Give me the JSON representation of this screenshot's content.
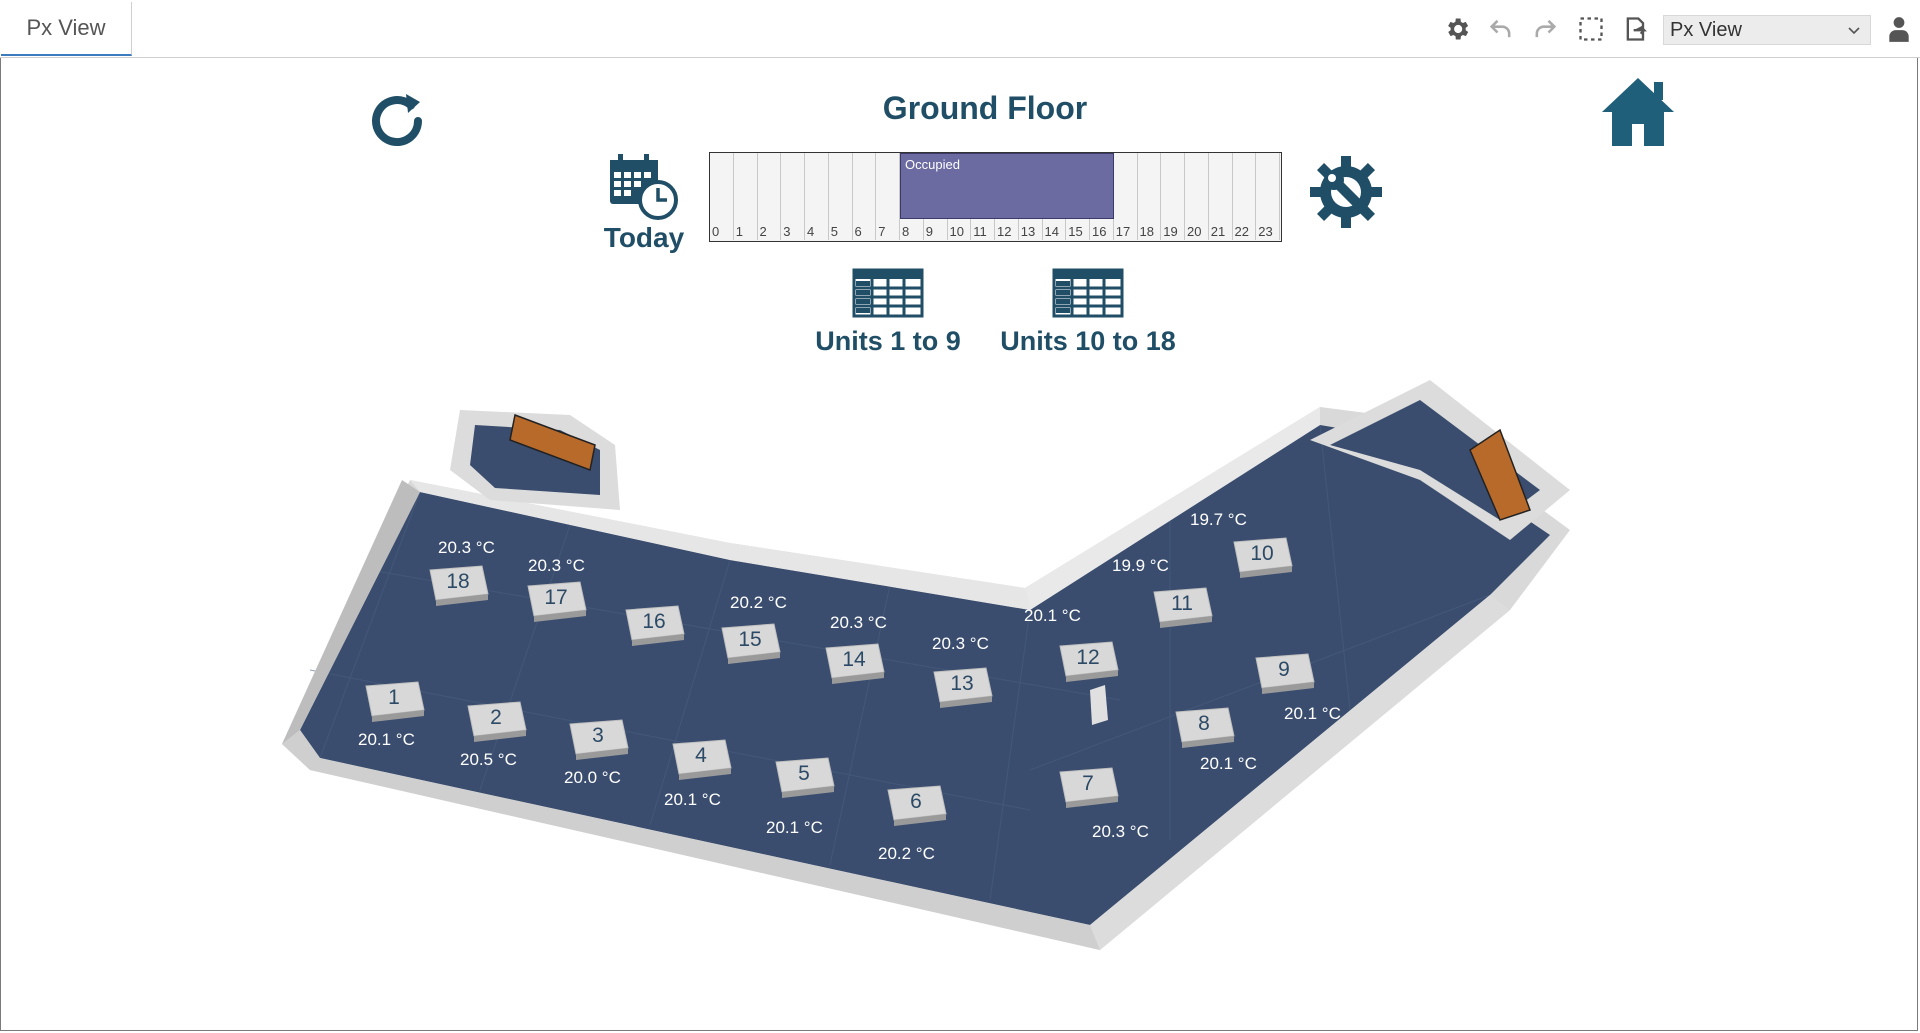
{
  "tab": {
    "label": "Px View"
  },
  "toolbar": {
    "icons": [
      "settings-icon",
      "undo-icon",
      "redo-icon",
      "selection-icon",
      "export-icon",
      "user-icon"
    ],
    "view_select": "Px View"
  },
  "header": {
    "title": "Ground Floor",
    "today_label": "Today",
    "units_a_label": "Units 1 to 9",
    "units_b_label": "Units 10 to 18"
  },
  "schedule": {
    "hours": [
      "0",
      "1",
      "2",
      "3",
      "4",
      "5",
      "6",
      "7",
      "8",
      "9",
      "10",
      "11",
      "12",
      "13",
      "14",
      "15",
      "16",
      "17",
      "18",
      "19",
      "20",
      "21",
      "22",
      "23"
    ],
    "occupied_label": "Occupied",
    "occupied_start": 8,
    "occupied_end": 17,
    "occupied_color": "#6b6aa1"
  },
  "colors": {
    "accent": "#1f4e66",
    "floor": "#3a4d6e"
  },
  "units": [
    {
      "id": "1",
      "temp": "20.1 °C"
    },
    {
      "id": "2",
      "temp": "20.5 °C"
    },
    {
      "id": "3",
      "temp": "20.0 °C"
    },
    {
      "id": "4",
      "temp": "20.1 °C"
    },
    {
      "id": "5",
      "temp": "20.1 °C"
    },
    {
      "id": "6",
      "temp": "20.2 °C"
    },
    {
      "id": "7",
      "temp": "20.3 °C"
    },
    {
      "id": "8",
      "temp": "20.1 °C"
    },
    {
      "id": "9",
      "temp": "20.1 °C"
    },
    {
      "id": "10",
      "temp": "19.7 °C"
    },
    {
      "id": "11",
      "temp": "19.9 °C"
    },
    {
      "id": "12",
      "temp": "20.1 °C"
    },
    {
      "id": "13",
      "temp": "20.3 °C"
    },
    {
      "id": "14",
      "temp": "20.3 °C"
    },
    {
      "id": "15",
      "temp": "20.2 °C"
    },
    {
      "id": "16",
      "temp": ""
    },
    {
      "id": "17",
      "temp": "20.3 °C"
    },
    {
      "id": "18",
      "temp": "20.3 °C"
    }
  ]
}
